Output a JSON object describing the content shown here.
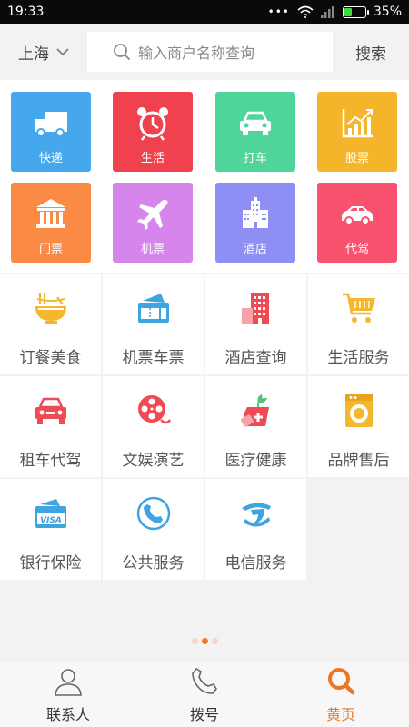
{
  "status_bar": {
    "time": "19:33",
    "battery": "35%",
    "battery_level": 0.35
  },
  "header": {
    "city": "上海",
    "search_placeholder": "输入商户名称查询",
    "search_button": "搜索"
  },
  "tiles": [
    {
      "label": "快递",
      "icon": "truck-icon",
      "color": "#46a8ec"
    },
    {
      "label": "生活",
      "icon": "alarm-clock-icon",
      "color": "#f0414f"
    },
    {
      "label": "打车",
      "icon": "car-icon",
      "color": "#4fd499"
    },
    {
      "label": "股票",
      "icon": "stock-chart-icon",
      "color": "#f5b52a"
    },
    {
      "label": "门票",
      "icon": "museum-icon",
      "color": "#fb8a44"
    },
    {
      "label": "机票",
      "icon": "airplane-icon",
      "color": "#d585ec"
    },
    {
      "label": "酒店",
      "icon": "hotel-icon",
      "color": "#8f8ef4"
    },
    {
      "label": "代驾",
      "icon": "sedan-icon",
      "color": "#f8526e"
    }
  ],
  "services": [
    {
      "label": "订餐美食",
      "icon": "noodle-bowl-icon"
    },
    {
      "label": "机票车票",
      "icon": "ticket-icon"
    },
    {
      "label": "酒店查询",
      "icon": "building-icon"
    },
    {
      "label": "生活服务",
      "icon": "shopping-cart-icon"
    },
    {
      "label": "租车代驾",
      "icon": "rental-car-icon"
    },
    {
      "label": "文娱演艺",
      "icon": "film-reel-icon"
    },
    {
      "label": "医疗健康",
      "icon": "medical-kit-icon"
    },
    {
      "label": "品牌售后",
      "icon": "washing-machine-icon"
    },
    {
      "label": "银行保险",
      "icon": "visa-card-icon"
    },
    {
      "label": "公共服务",
      "icon": "phone-icon"
    },
    {
      "label": "电信服务",
      "icon": "telecom-logo-icon"
    }
  ],
  "pager": {
    "pages": 3,
    "active": 2
  },
  "bottom_nav": [
    {
      "label": "联系人",
      "icon": "contact-person-icon"
    },
    {
      "label": "拨号",
      "icon": "dial-phone-icon"
    },
    {
      "label": "黄页",
      "icon": "search-icon",
      "active": true
    }
  ],
  "colors": {
    "accent": "#ee7622",
    "service_blue": "#3ea4e2",
    "service_red": "#ee4b55",
    "service_yellow": "#f4b72e"
  }
}
